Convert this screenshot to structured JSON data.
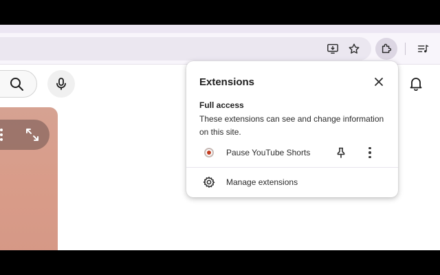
{
  "toolbar": {
    "icons": [
      "install-app-icon",
      "bookmark-star-icon",
      "extensions-puzzle-icon",
      "media-queue-icon"
    ]
  },
  "page": {
    "icons": [
      "search-icon",
      "microphone-icon",
      "notifications-bell-icon",
      "more-vertical-icon",
      "expand-icon"
    ],
    "video_card_color": "#d99c89"
  },
  "extensions_popup": {
    "title": "Extensions",
    "section_title": "Full access",
    "section_description": "These extensions can see and change information on this site.",
    "extensions": [
      {
        "name": "Pause YouTube Shorts",
        "favicon_color": "#c23c1f",
        "icons": [
          "pin-icon",
          "more-vertical-icon"
        ]
      }
    ],
    "manage_label": "Manage extensions"
  },
  "colors": {
    "tabstrip": "#ece6f3",
    "toolbar": "#f8f5fb",
    "omnibox": "#ebe7f0",
    "extensions_button_active": "#dcd6e3"
  }
}
